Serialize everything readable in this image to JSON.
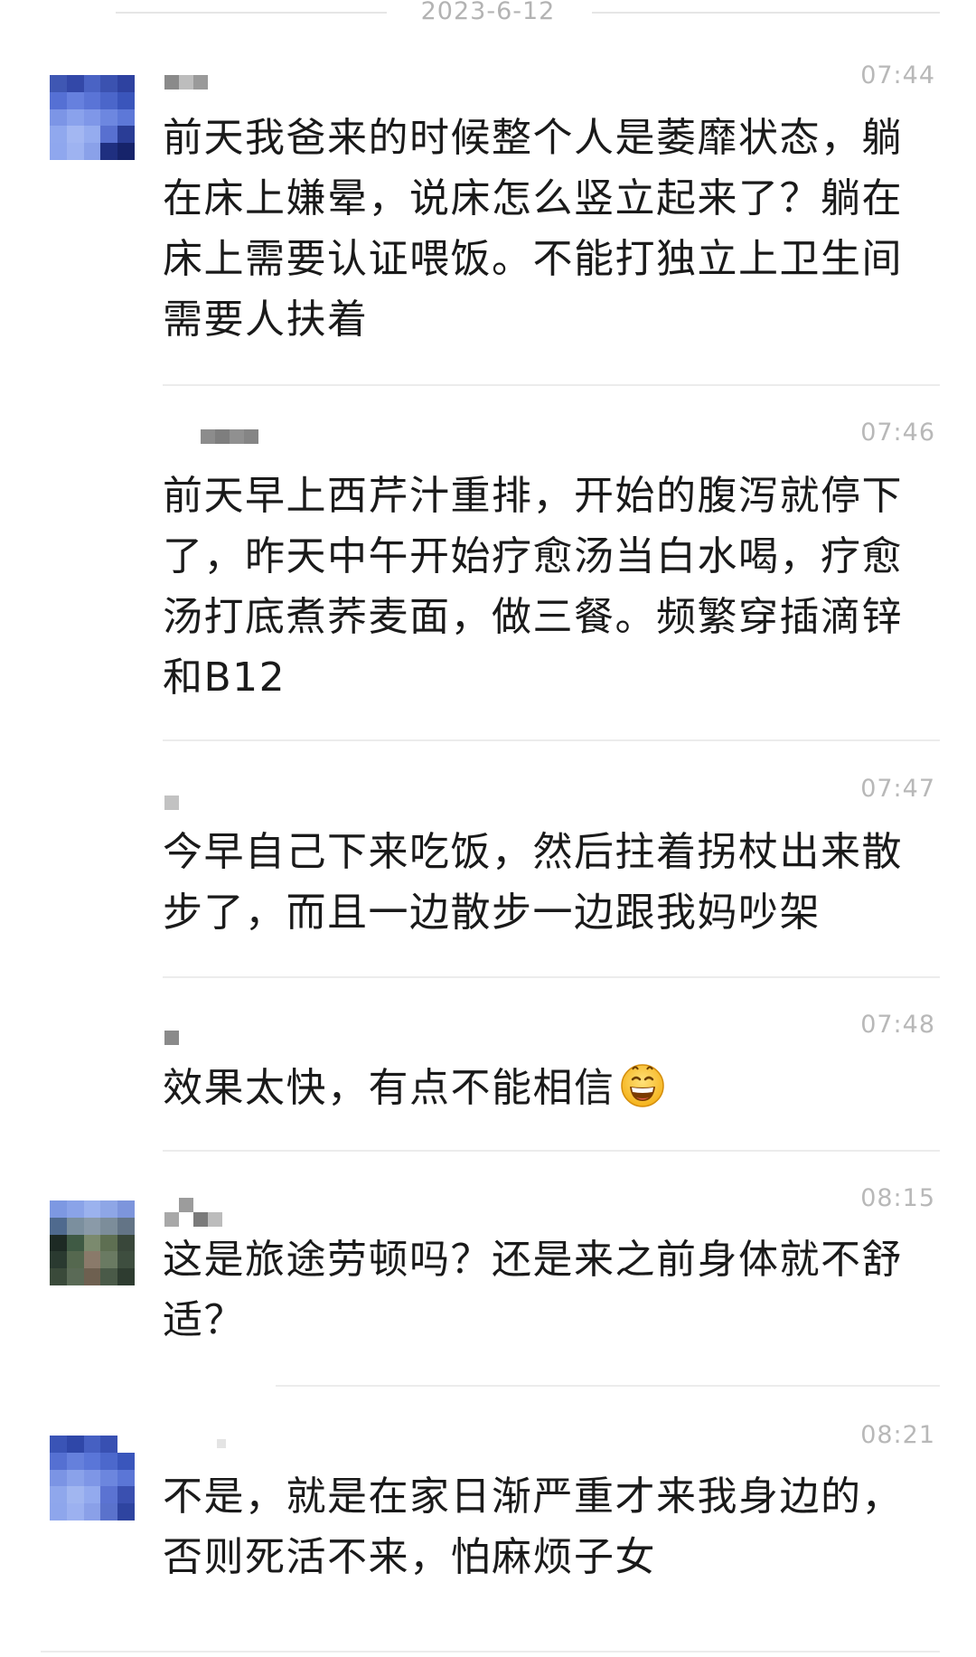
{
  "date": "2023-6-12",
  "messages": [
    {
      "time": "07:44",
      "text": "前天我爸来的时候整个人是萎靡状态，躺在床上嫌晕，说床怎么竖立起来了？躺在床上需要认证喂饭。不能打独立上卫生间需要人扶着"
    },
    {
      "time": "07:46",
      "text": "前天早上西芹汁重排，开始的腹泻就停下了，昨天中午开始疗愈汤当白水喝，疗愈汤打底煮荞麦面，做三餐。频繁穿插滴锌和B12"
    },
    {
      "time": "07:47",
      "text": "今早自己下来吃饭，然后拄着拐杖出来散步了，而且一边散步一边跟我妈吵架"
    },
    {
      "time": "07:48",
      "text": "效果太快，有点不能相信",
      "emoji": "grinning-sweat-emoji"
    },
    {
      "time": "08:15",
      "text": "这是旅途劳顿吗？还是来之前身体就不舒适？"
    },
    {
      "time": "08:21",
      "text": "不是，就是在家日渐严重才来我身边的，否则死活不来，怕麻烦子女"
    }
  ],
  "colors": {
    "text": "#1a1a1a",
    "time": "#b8b8b8",
    "date": "#b3b3b3",
    "separator": "#ececec"
  }
}
